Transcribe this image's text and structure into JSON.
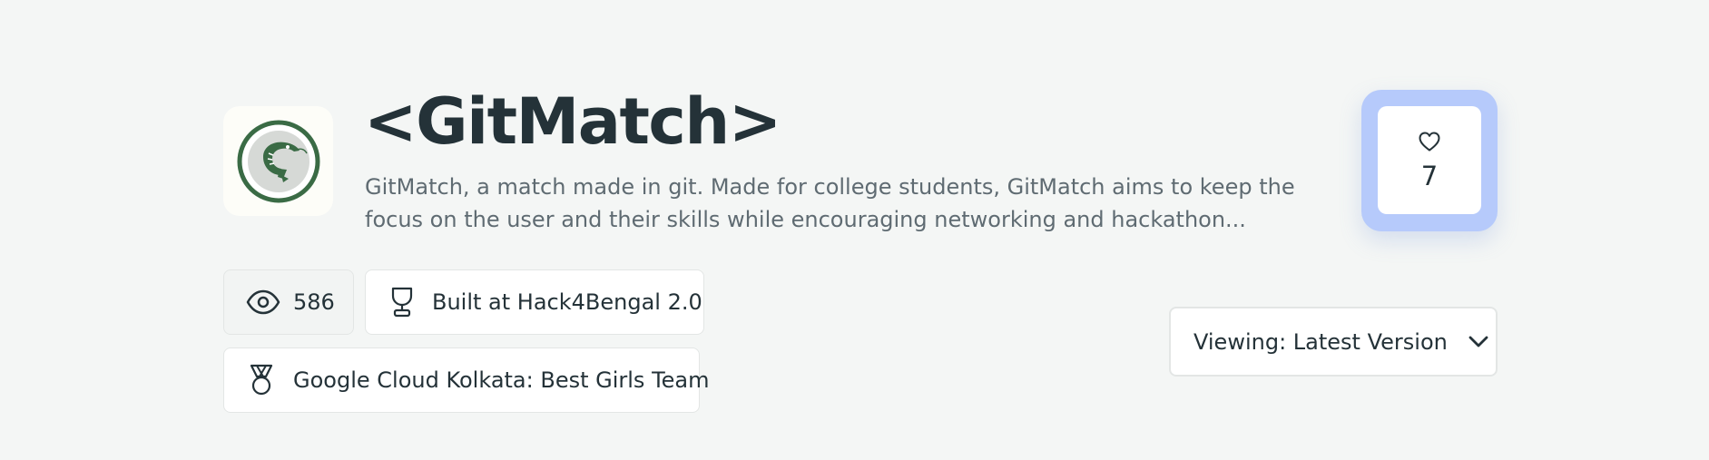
{
  "project": {
    "title": "<GitMatch>",
    "description": "GitMatch, a match made in git. Made for college students, GitMatch aims to keep the focus on the user and their skills while encouraging networking and hackathon...",
    "logo_icon": "shrimp-logo-icon"
  },
  "likes": {
    "icon": "heart-icon",
    "count": "7"
  },
  "stats": {
    "views_icon": "eye-icon",
    "views": "586",
    "event_icon": "trophy-icon",
    "event": "Built at Hack4Bengal 2.0",
    "prize_icon": "medal-icon",
    "prize": "Google Cloud Kolkata: Best Girls Team"
  },
  "version": {
    "label": "Viewing: Latest Version",
    "icon": "chevron-down-icon"
  },
  "colors": {
    "background": "#f4f6f5",
    "title": "#243238",
    "description": "#5f6b72",
    "like_accent": "#b6cafb",
    "logo_ring": "#3a6b45",
    "logo_inner": "#d6d9d6"
  }
}
